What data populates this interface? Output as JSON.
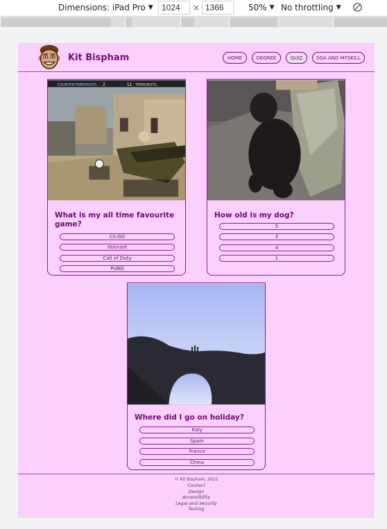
{
  "devtools": {
    "dimensions_label": "Dimensions: iPad Pro",
    "width_value": "1024",
    "height_value": "1366",
    "times_symbol": "×",
    "zoom_label": "50%",
    "throttle_label": "No throttling",
    "caret": "▼"
  },
  "site": {
    "brand": "Kit Bispham",
    "nav": [
      {
        "label": "HOME"
      },
      {
        "label": "DEGREE"
      },
      {
        "label": "QUIZ"
      },
      {
        "label": "SGA AND MYSKILL"
      }
    ]
  },
  "quiz": [
    {
      "question": "What is my all time favourite game?",
      "answers": [
        "CS:GO",
        "Valorant",
        "Call of Duty",
        "PUBG"
      ],
      "hud": {
        "left_team": "COUNTER-TERRORISTS",
        "left_score": "2",
        "right_score": "11",
        "right_team": "TERRORISTS"
      }
    },
    {
      "question": "How old is my dog?",
      "answers": [
        "5",
        "2",
        "4",
        "1"
      ]
    },
    {
      "question": "Where did I go on holiday?",
      "answers": [
        "Italy",
        "Spain",
        "France",
        "China"
      ]
    }
  ],
  "footer": {
    "copyright": "© Kit Bispham, 2022",
    "links": [
      "Contact",
      "Design",
      "Accessibility",
      "Legal and security",
      "Testing"
    ]
  },
  "colors": {
    "page_bg": "#fbd0fd",
    "accent": "#7a0c7e"
  }
}
